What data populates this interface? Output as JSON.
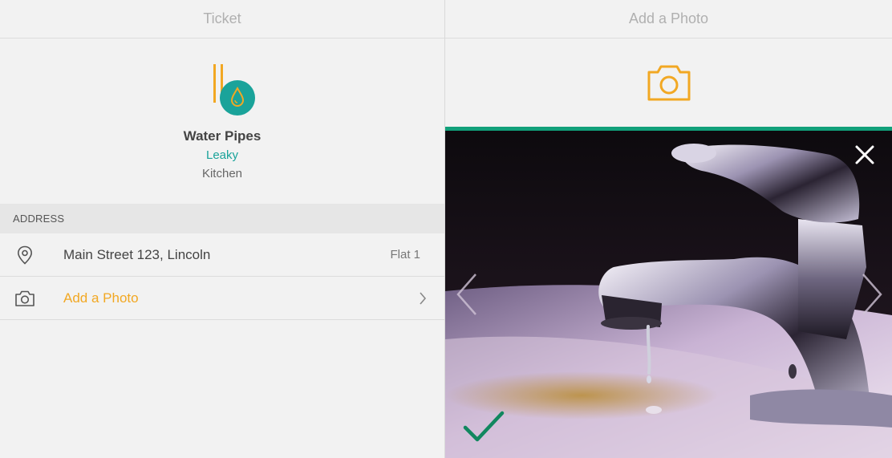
{
  "left_pane": {
    "header_title": "Ticket",
    "ticket": {
      "category_icon": "water-pipes-icon",
      "title": "Water Pipes",
      "status": "Leaky",
      "room": "Kitchen"
    },
    "address_section": {
      "header": "ADDRESS",
      "address_icon": "location-pin-icon",
      "address": "Main Street 123, Lincoln",
      "unit": "Flat 1"
    },
    "photo_row": {
      "icon": "camera-icon",
      "label": "Add a Photo",
      "chevron": "chevron-right-icon"
    }
  },
  "right_pane": {
    "header_title": "Add a Photo",
    "camera_icon": "camera-icon",
    "photo": {
      "subject": "dripping-faucet-photo",
      "close_icon": "close-icon",
      "prev_icon": "chevron-left-icon",
      "next_icon": "chevron-right-icon",
      "confirm_icon": "checkmark-icon"
    }
  },
  "colors": {
    "accent_orange": "#f2a823",
    "accent_teal": "#1aa39a",
    "accent_green": "#11a07a",
    "background": "#f2f2f2"
  }
}
